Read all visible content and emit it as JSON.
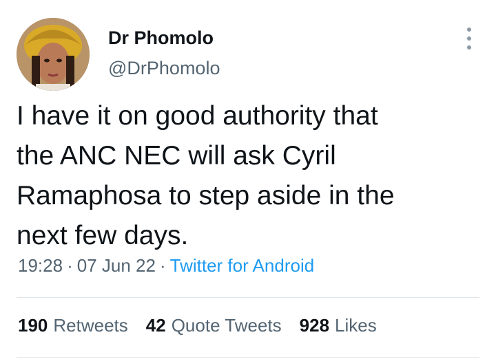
{
  "user": {
    "display_name": "Dr Phomolo",
    "handle": "@DrPhomolo",
    "avatar_icon": "profile-photo"
  },
  "tweet": {
    "text": "I have it on good authority that\nthe ANC NEC will ask Cyril\nRamaphosa to step aside in the\nnext few days.",
    "time": "19:28",
    "date": "07 Jun 22",
    "source": "Twitter for Android",
    "separator": "·"
  },
  "stats": {
    "retweets_count": "190",
    "retweets_label": "Retweets",
    "quotes_count": "42",
    "quotes_label": "Quote Tweets",
    "likes_count": "928",
    "likes_label": "Likes"
  },
  "colors": {
    "text": "#0f1419",
    "secondary": "#536471",
    "link": "#1d9bf0"
  }
}
